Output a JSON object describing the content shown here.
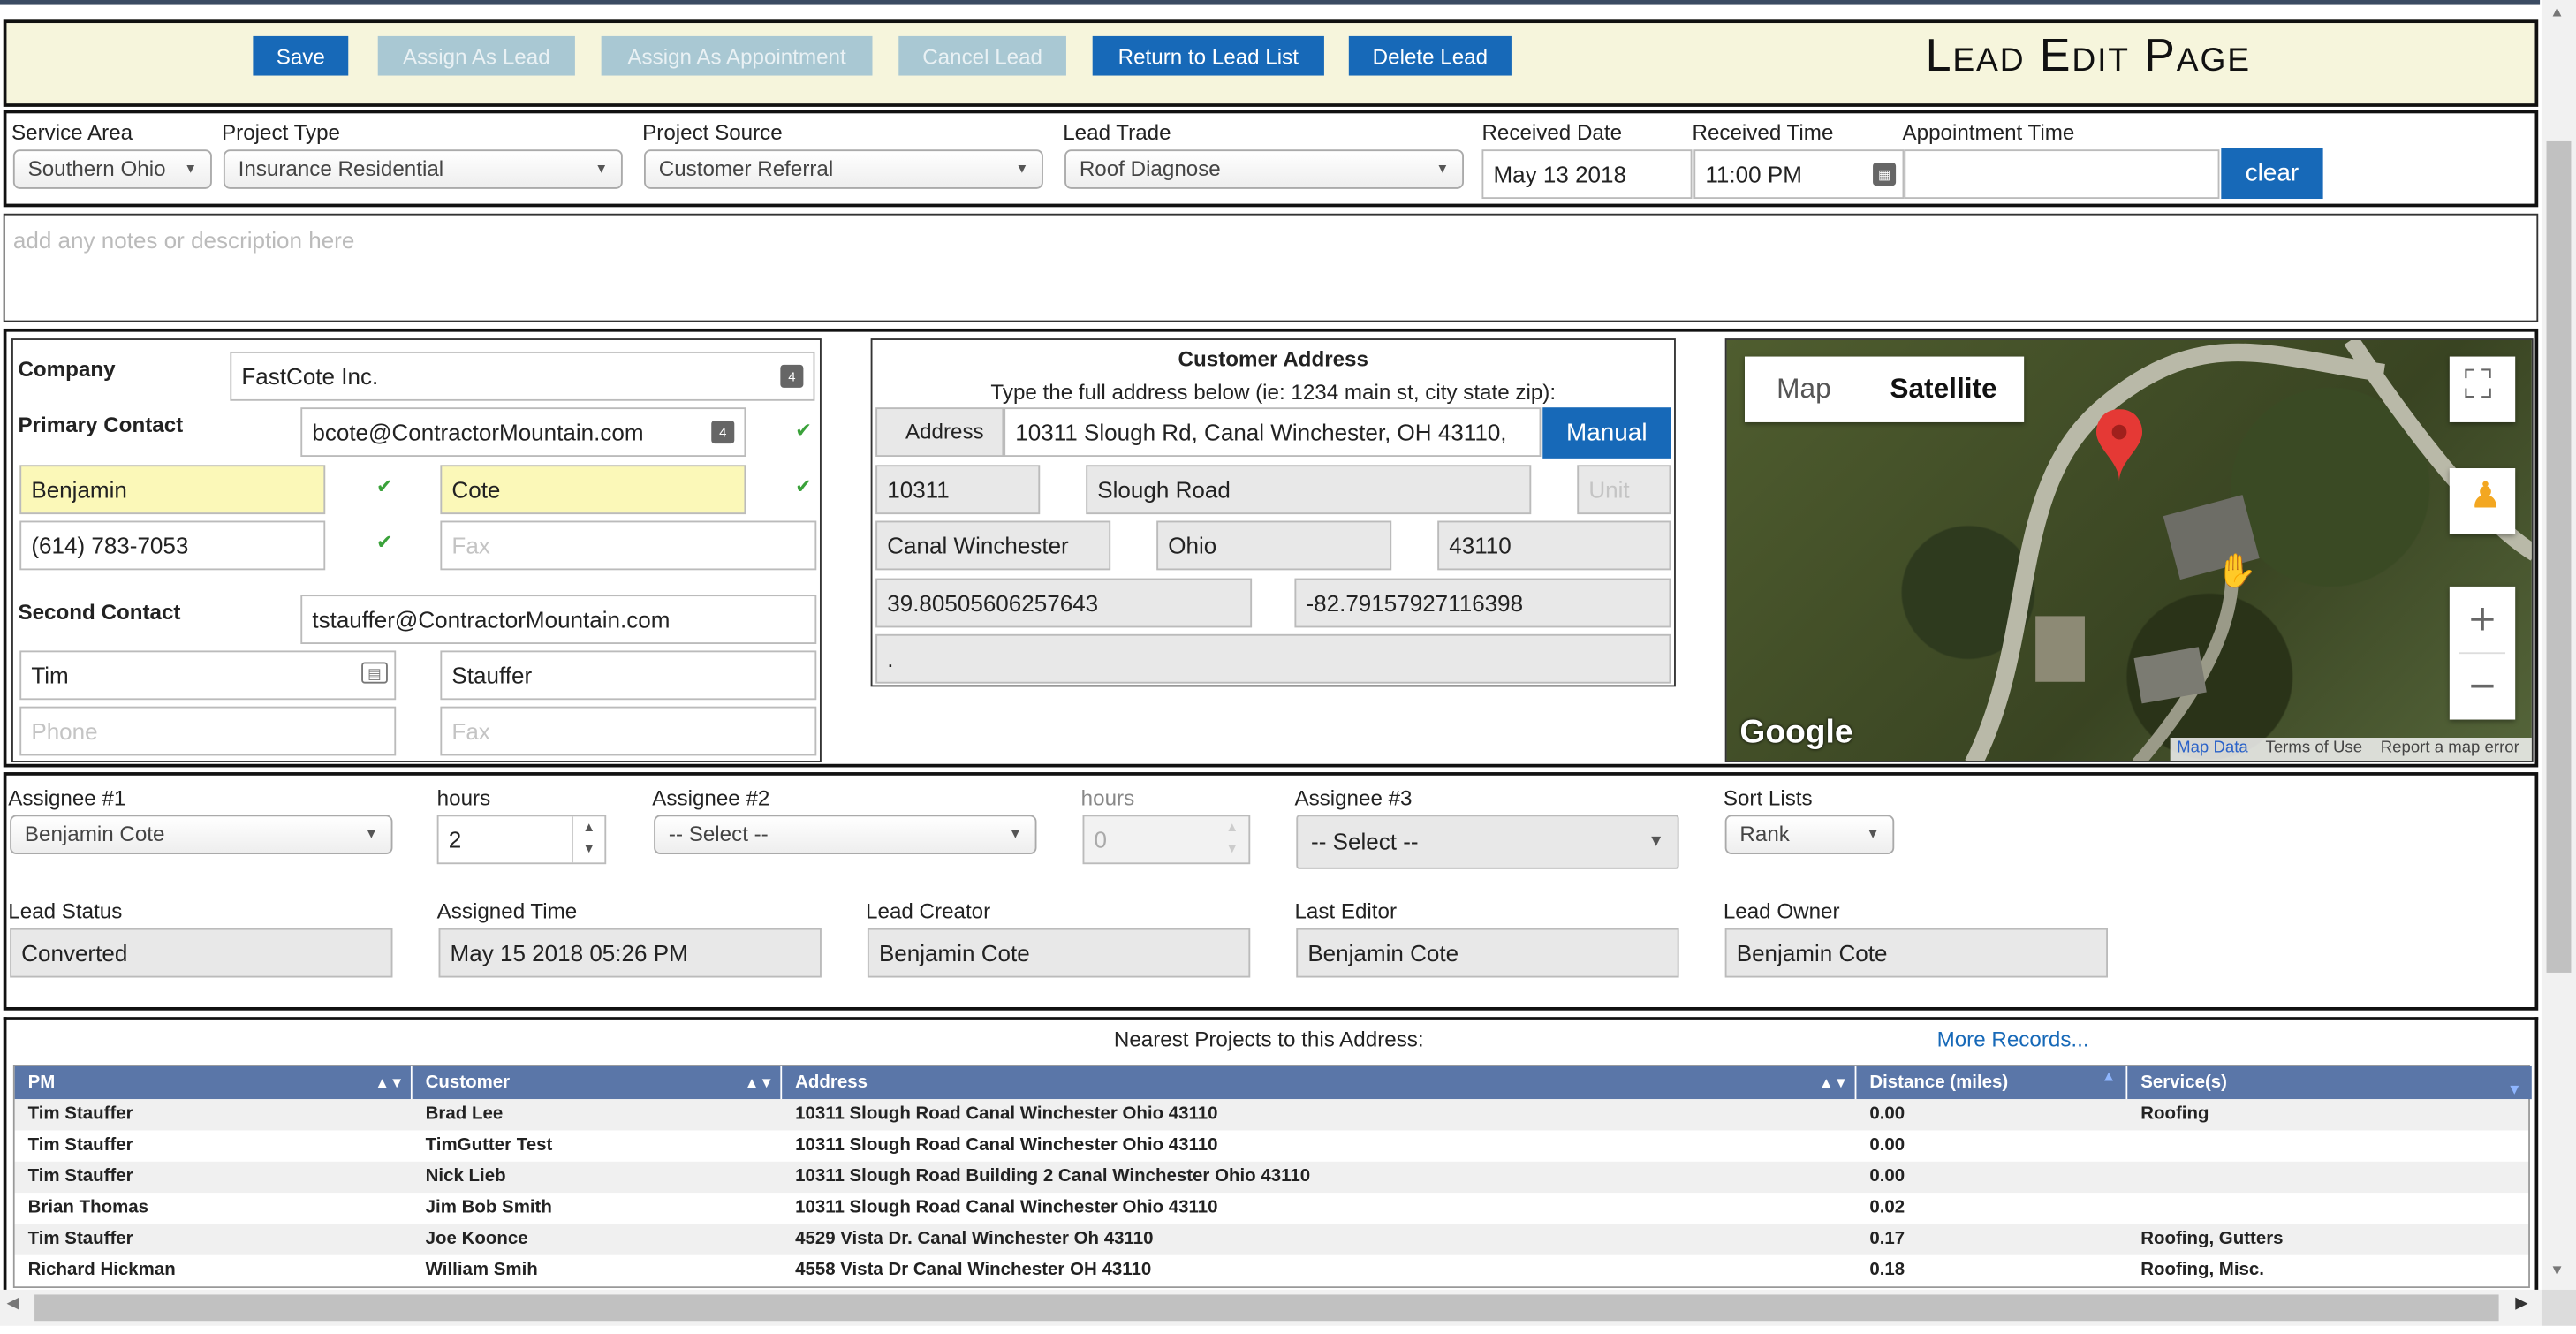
{
  "header": {
    "title": "Lead Edit Page",
    "buttons": {
      "save": "Save",
      "assign_lead": "Assign As Lead",
      "assign_appointment": "Assign As Appointment",
      "cancel_lead": "Cancel Lead",
      "return_list": "Return to Lead List",
      "delete_lead": "Delete Lead"
    }
  },
  "lead_info": {
    "service_area": {
      "label": "Service Area",
      "value": "Southern Ohio"
    },
    "project_type": {
      "label": "Project Type",
      "value": "Insurance Residential"
    },
    "project_source": {
      "label": "Project Source",
      "value": "Customer Referral"
    },
    "lead_trade": {
      "label": "Lead Trade",
      "value": "Roof Diagnose"
    },
    "received_date": {
      "label": "Received Date",
      "value": "May 13 2018"
    },
    "received_time": {
      "label": "Received Time",
      "value": "11:00 PM"
    },
    "appointment_time": {
      "label": "Appointment Time",
      "value": ""
    },
    "clear_label": "clear"
  },
  "notes": {
    "placeholder": "add any notes or description here"
  },
  "contact": {
    "company_label": "Company",
    "company_value": "FastCote Inc.",
    "primary_label": "Primary Contact",
    "primary_email": "bcote@ContractorMountain.com",
    "primary_first": "Benjamin",
    "primary_last": "Cote",
    "primary_phone": "(614) 783-7053",
    "primary_fax_placeholder": "Fax",
    "second_label": "Second Contact",
    "second_email": "tstauffer@ContractorMountain.com",
    "second_first": "Tim",
    "second_last": "Stauffer",
    "second_phone_placeholder": "Phone",
    "second_fax_placeholder": "Fax",
    "mini_icon_text": "4"
  },
  "address": {
    "title": "Customer Address",
    "hint": "Type the full address below (ie: 1234 main st, city state zip):",
    "address_label": "Address",
    "full_address": "10311 Slough Rd, Canal Winchester, OH 43110,",
    "manual_label": "Manual",
    "number": "10311",
    "street": "Slough Road",
    "unit_placeholder": "Unit",
    "city": "Canal Winchester",
    "state": "Ohio",
    "zip": "43110",
    "lat": "39.80505606257643",
    "lng": "-82.79157927116398",
    "extra": "."
  },
  "map": {
    "tab_map": "Map",
    "tab_satellite": "Satellite",
    "brand": "Google",
    "map_data": "Map Data",
    "terms": "Terms of Use",
    "report": "Report a map error"
  },
  "assignment": {
    "assignee1": {
      "label": "Assignee #1",
      "value": "Benjamin Cote"
    },
    "hours1": {
      "label": "hours",
      "value": "2"
    },
    "assignee2": {
      "label": "Assignee #2",
      "value": "-- Select --"
    },
    "hours2": {
      "label": "hours",
      "value": "0"
    },
    "assignee3": {
      "label": "Assignee #3",
      "value": "-- Select --"
    },
    "sort_lists": {
      "label": "Sort Lists",
      "value": "Rank"
    },
    "lead_status": {
      "label": "Lead Status",
      "value": "Converted"
    },
    "assigned_time": {
      "label": "Assigned Time",
      "value": "May 15 2018 05:26 PM"
    },
    "lead_creator": {
      "label": "Lead Creator",
      "value": "Benjamin Cote"
    },
    "last_editor": {
      "label": "Last Editor",
      "value": "Benjamin Cote"
    },
    "lead_owner": {
      "label": "Lead Owner",
      "value": "Benjamin Cote"
    }
  },
  "nearest": {
    "title": "Nearest Projects to this Address:",
    "more": "More Records...",
    "columns": [
      "PM",
      "Customer",
      "Address",
      "Distance (miles)",
      "Service(s)"
    ],
    "rows": [
      [
        "Tim Stauffer",
        "Brad Lee",
        "10311 Slough Road Canal Winchester Ohio 43110",
        "0.00",
        "Roofing"
      ],
      [
        "Tim Stauffer",
        "TimGutter Test",
        "10311 Slough Road Canal Winchester Ohio 43110",
        "0.00",
        ""
      ],
      [
        "Tim Stauffer",
        "Nick Lieb",
        "10311 Slough Road Building 2 Canal Winchester Ohio 43110",
        "0.00",
        ""
      ],
      [
        "Brian Thomas",
        "Jim Bob Smith",
        "10311 Slough Road Canal Winchester Ohio 43110",
        "0.02",
        ""
      ],
      [
        "Tim Stauffer",
        "Joe Koonce",
        "4529 Vista Dr. Canal Winchester Oh 43110",
        "0.17",
        "Roofing, Gutters"
      ],
      [
        "Richard Hickman",
        "William Smih",
        "4558 Vista Dr Canal Winchester OH 43110",
        "0.18",
        "Roofing, Misc."
      ]
    ]
  },
  "colors": {
    "primary_button": "#1769b8",
    "disabled_button": "#a9c8d3",
    "header_bg": "#f6f5dc",
    "grid_header": "#5a76a8",
    "highlight_field": "#fbf8b8"
  }
}
